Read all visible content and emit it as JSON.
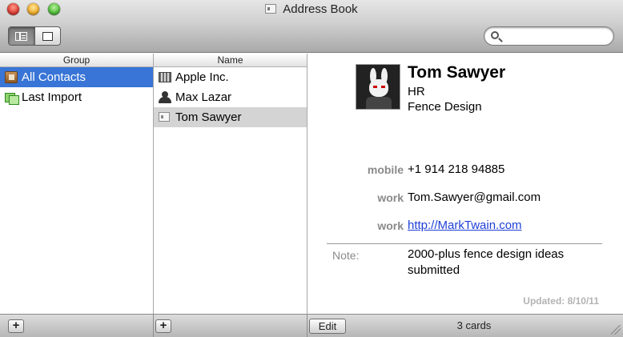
{
  "window": {
    "title": "Address Book"
  },
  "toolbar": {
    "search": {
      "value": "",
      "placeholder": ""
    }
  },
  "groups": {
    "header": "Group",
    "items": [
      {
        "label": "All Contacts",
        "icon": "address-book-icon",
        "selected": true
      },
      {
        "label": "Last Import",
        "icon": "import-group-icon",
        "selected": false
      }
    ]
  },
  "names": {
    "header": "Name",
    "items": [
      {
        "label": "Apple Inc.",
        "icon": "company-icon",
        "selected": false
      },
      {
        "label": "Max Lazar",
        "icon": "person-icon",
        "selected": false
      },
      {
        "label": "Tom Sawyer",
        "icon": "card-icon",
        "selected": true
      }
    ]
  },
  "card": {
    "name": "Tom Sawyer",
    "department": "HR",
    "company": "Fence Design",
    "fields": [
      {
        "label": "mobile",
        "value": "+1 914 218 94885"
      },
      {
        "label": "work",
        "value": "Tom.Sawyer@gmail.com"
      },
      {
        "label": "work",
        "value": "http://MarkTwain.com"
      }
    ],
    "note_label": "Note:",
    "note": "2000-plus fence design ideas submitted",
    "updated": "Updated: 8/10/11"
  },
  "bottom": {
    "add_label": "+",
    "edit_label": "Edit",
    "count": "3 cards"
  },
  "colors": {
    "selection": "#3875d7",
    "link": "#1f3fd6"
  }
}
